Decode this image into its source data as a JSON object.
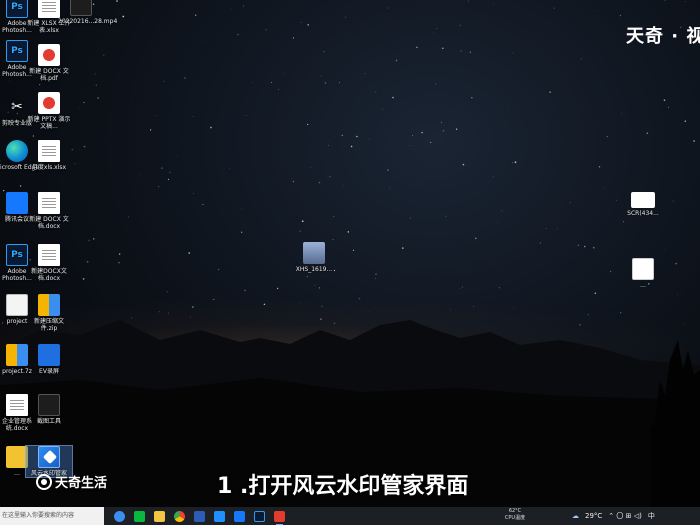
{
  "desktop": {
    "icons": [
      {
        "name": "photoshop-icon",
        "label": "Adobe Photosh...",
        "kind": "ps",
        "glyph": "Ps"
      },
      {
        "name": "xlsx-file-icon",
        "label": "新建 XLSX 工作表.xlsx",
        "kind": "doc"
      },
      {
        "name": "mp4-file-icon",
        "label": "20220216...28.mp4",
        "kind": "dark"
      },
      {
        "name": "photoshop-icon-2",
        "label": "Adobe Photosh...",
        "kind": "ps",
        "glyph": "Ps"
      },
      {
        "name": "pdf-file-icon",
        "label": "新建 DOCX 文档.pdf",
        "kind": "pdf"
      },
      {
        "name": "capcut-icon",
        "label": "剪映专业版",
        "kind": "capcut",
        "glyph": "✂"
      },
      {
        "name": "pptx-file-icon",
        "label": "新建 PPTX 演示文稿...",
        "kind": "pdf"
      },
      {
        "name": "edge-icon",
        "label": "Microsoft Edge",
        "kind": "edge"
      },
      {
        "name": "xlsx-file-icon-2",
        "label": "月度xls.xlsx",
        "kind": "doc"
      },
      {
        "name": "tencent-meeting-icon",
        "label": "腾讯会议",
        "kind": "blue"
      },
      {
        "name": "docx-file-icon",
        "label": "新建 DOCX 文档.docx",
        "kind": "doc"
      },
      {
        "name": "photoshop-icon-3",
        "label": "Adobe Photosh...",
        "kind": "ps",
        "glyph": "Ps"
      },
      {
        "name": "docx-file-icon-2",
        "label": "新建DOCX文档.docx",
        "kind": "doc"
      },
      {
        "name": "project-file-icon",
        "label": "project",
        "kind": "file"
      },
      {
        "name": "zip-file-icon",
        "label": "新建压缩文件.zip",
        "kind": "zip"
      },
      {
        "name": "project-7z-icon",
        "label": "project.7z",
        "kind": "zip"
      },
      {
        "name": "ev-recorder-icon",
        "label": "EV录屏",
        "kind": "video"
      },
      {
        "name": "docx-file-icon-3",
        "label": "企业管理系统.docx",
        "kind": "doc"
      },
      {
        "name": "screenshot-icon",
        "label": "截图工具",
        "kind": "dark"
      },
      {
        "name": "file-icon",
        "label": "...",
        "kind": "yellow"
      },
      {
        "name": "watermark-manager-icon",
        "label": "风云水印管家",
        "kind": "wm"
      },
      {
        "name": "xhs-image-icon",
        "label": "XHS_1619...",
        "kind": "xhs"
      },
      {
        "name": "screenshot-file-icon",
        "label": "SCR(434...",
        "kind": "scr"
      },
      {
        "name": "doc-file-icon-right",
        "label": "...",
        "kind": "cap"
      }
    ]
  },
  "watermark": {
    "top_right": "天奇 · 视"
  },
  "caption": "1 .打开风云水印管家界面",
  "brand": {
    "name": "天奇生活"
  },
  "taskbar": {
    "search_placeholder": "在这里输入你要搜索的内容",
    "weather_temp": "62°C",
    "weather_label": "CPU温度",
    "temperature": "29°C",
    "tray_cloud": "☁",
    "tray_icons": "⌃ 〇 ⊞ ◁)",
    "ime": "中"
  },
  "colors": {
    "accent": "#2d8cf0",
    "taskbar": "#1c1f24"
  }
}
